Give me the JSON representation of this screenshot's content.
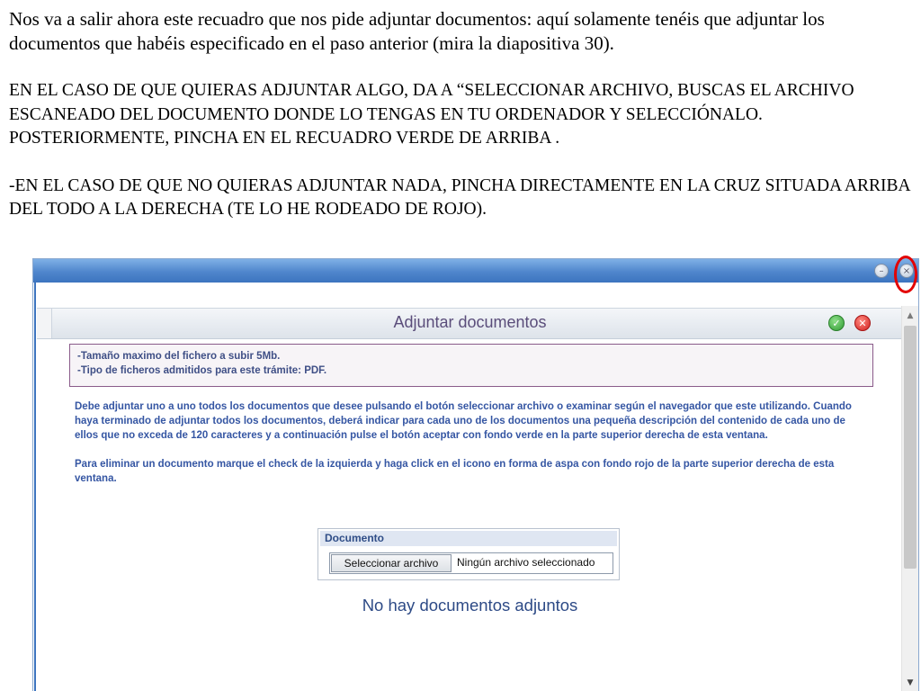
{
  "slide": {
    "paragraph1": "Nos va a salir ahora este recuadro que nos pide adjuntar documentos: aquí solamente tenéis que adjuntar los documentos que habéis especificado en el paso anterior (mira la diapositiva  30).",
    "paragraph2": "EN EL CASO DE QUE QUIERAS ADJUNTAR ALGO, DA A “SELECCIONAR ARCHIVO, BUSCAS EL ARCHIVO ESCANEADO DEL DOCUMENTO DONDE LO TENGAS EN TU ORDENADOR Y SELECCIÓNALO. POSTERIORMENTE, PINCHA EN EL RECUADRO VERDE DE ARRIBA .",
    "paragraph3": "-EN EL CASO DE QUE NO QUIERAS ADJUNTAR NADA, PINCHA DIRECTAMENTE  EN LA CRUZ SITUADA ARRIBA DEL TODO A LA DERECHA (TE LO HE RODEADO DE ROJO)."
  },
  "colors": {
    "titlebar": "#4f86cc",
    "highlight_ring": "#e30000",
    "accept": "#2f9a32",
    "reject": "#d21f1f",
    "header_title": "#5a4d7a",
    "instruction_text": "#3556a3"
  },
  "window": {
    "minimize_icon": "minimize-icon",
    "close_icon": "close-icon"
  },
  "dialog": {
    "title": "Adjuntar documentos",
    "accept_icon": "check-icon",
    "reject_icon": "x-icon",
    "info_lines": [
      "-Tamaño maximo del fichero a subir 5Mb.",
      "-Tipo de ficheros admitidos para este trámite: PDF."
    ],
    "instructions": [
      "Debe adjuntar uno a uno todos los documentos que desee pulsando el botón seleccionar archivo o examinar según el navegador que este utilizando. Cuando haya terminado de adjuntar todos los documentos, deberá indicar para cada uno de los documentos una pequeña descripción del contenido de cada uno de ellos que no exceda de 120 caracteres y a continuación pulse el botón aceptar con fondo verde en la parte superior derecha de esta ventana.",
      "Para eliminar un documento marque el check de la izquierda y haga click en el icono en forma de aspa con fondo rojo de la parte superior derecha de esta ventana."
    ],
    "document_label": "Documento",
    "file_button": "Seleccionar archivo",
    "file_status": "Ningún archivo seleccionado",
    "empty_message": "No hay documentos adjuntos"
  }
}
